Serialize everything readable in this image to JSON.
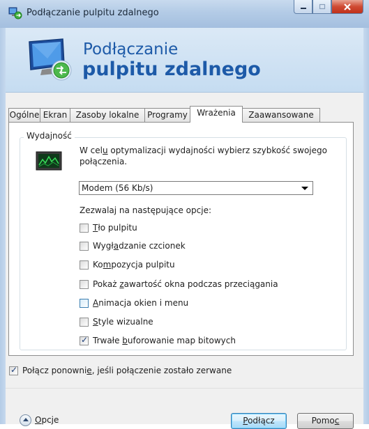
{
  "window": {
    "title": "Podłączanie pulpitu zdalnego"
  },
  "banner": {
    "line1": "Podłączanie",
    "line2": "pulpitu zdalnego"
  },
  "tabs": [
    {
      "label": "Ogólne",
      "active": false
    },
    {
      "label": "Ekran",
      "active": false
    },
    {
      "label": "Zasoby lokalne",
      "active": false
    },
    {
      "label": "Programy",
      "active": false
    },
    {
      "label": "Wrażenia",
      "active": true
    },
    {
      "label": "Zaawansowane",
      "active": false
    }
  ],
  "performance": {
    "group_label": "Wydajność",
    "description_pre": "W cel",
    "description_u": "u",
    "description_post": " optymalizacji wydajności wybierz szybkość swojego połączenia.",
    "speed_select": {
      "value": "Modem (56 Kb/s)"
    },
    "allow_label": "Zezwalaj na następujące opcje:",
    "options": [
      {
        "pre": "",
        "u": "T",
        "post": "ło pulpitu",
        "checked": false
      },
      {
        "pre": "Wygł",
        "u": "a",
        "post": "dzanie czcionek",
        "checked": false
      },
      {
        "pre": "Ko",
        "u": "m",
        "post": "pozycja pulpitu",
        "checked": false
      },
      {
        "pre": "Pokaż ",
        "u": "z",
        "post": "awartość okna podczas przeciągania",
        "checked": false
      },
      {
        "pre": "",
        "u": "A",
        "post": "nimacja okien i menu",
        "checked": false
      },
      {
        "pre": "",
        "u": "S",
        "post": "tyle wizualne",
        "checked": false
      },
      {
        "pre": "Trwałe ",
        "u": "b",
        "post": "uforowanie map bitowych",
        "checked": true
      }
    ]
  },
  "reconnect": {
    "pre": "Połącz ponowni",
    "u": "e",
    "post": ", jeśli połączenie zostało zerwane",
    "checked": true
  },
  "footer": {
    "options_u": "O",
    "options_rest": "pcje",
    "connect_u": "P",
    "connect_rest": "odłącz",
    "help_pre": "Pomo",
    "help_u": "c"
  },
  "colors": {
    "banner_text": "#1d5aa8",
    "close_button": "#c0321b",
    "default_button_border": "#3c7fb1"
  }
}
